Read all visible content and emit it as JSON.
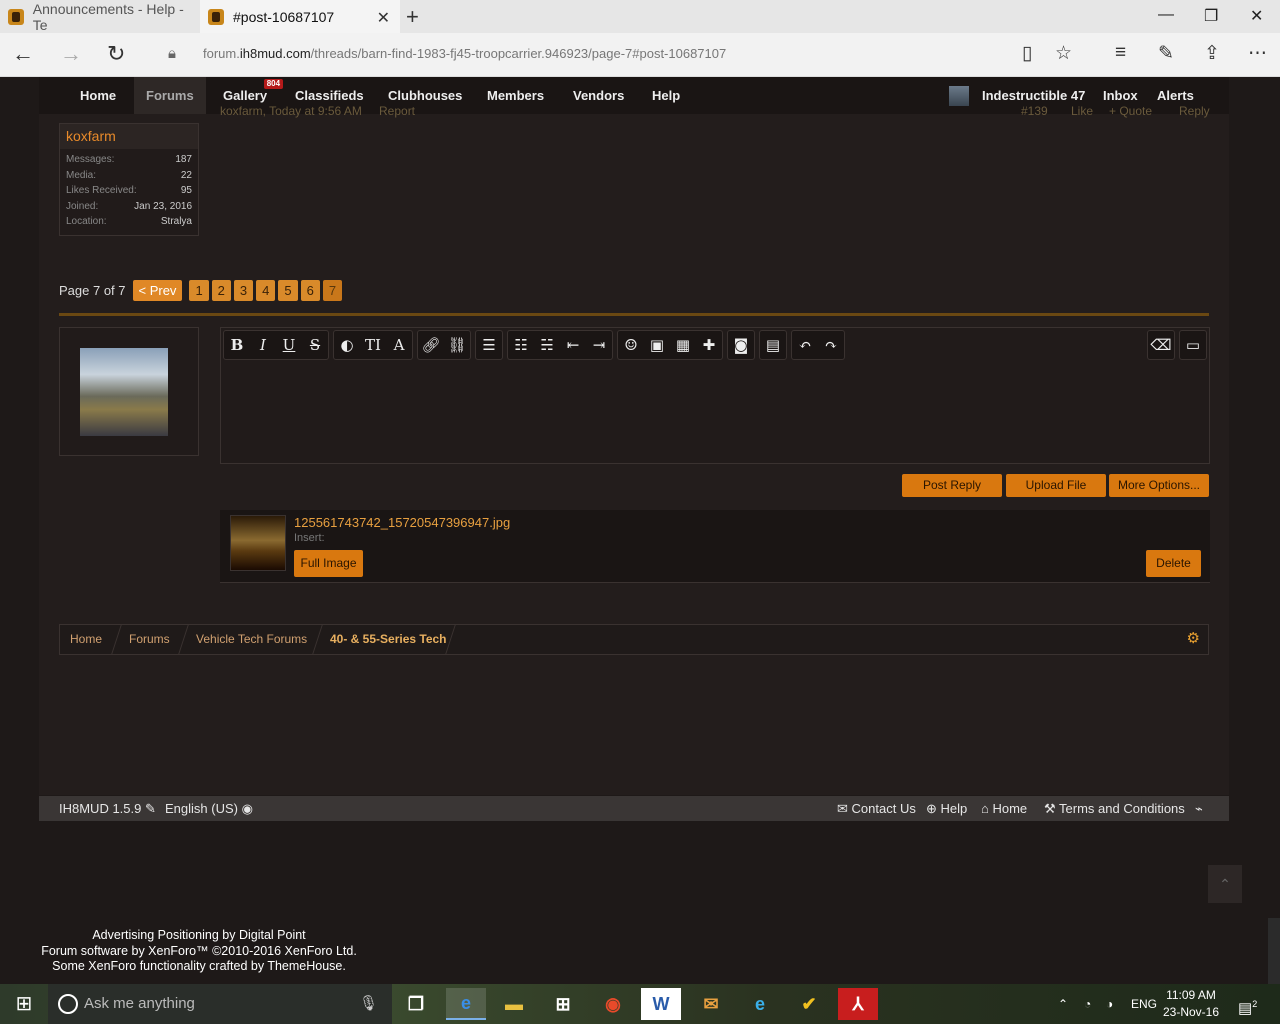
{
  "browser": {
    "tabs": [
      {
        "title": "Announcements - Help - Te"
      },
      {
        "title": "#post-10687107"
      }
    ],
    "url_prefix": "forum.",
    "url_domain": "ih8mud.com",
    "url_path": "/threads/barn-find-1983-fj45-troopcarrier.946923/page-7#post-10687107"
  },
  "nav": {
    "home": "Home",
    "forums": "Forums",
    "gallery": "Gallery",
    "gallery_badge": "804",
    "classifieds": "Classifieds",
    "clubhouses": "Clubhouses",
    "members": "Members",
    "vendors": "Vendors",
    "help": "Help",
    "username": "Indestructible 47",
    "inbox": "Inbox",
    "alerts": "Alerts"
  },
  "post_meta": {
    "author_time": "koxfarm, Today at 9:56 AM",
    "report": "Report",
    "number": "#139",
    "like": "Like",
    "quote": "+ Quote",
    "reply": "Reply"
  },
  "user": {
    "name": "koxfarm",
    "stats": [
      {
        "label": "Messages:",
        "value": "187"
      },
      {
        "label": "Media:",
        "value": "22"
      },
      {
        "label": "Likes Received:",
        "value": "95"
      },
      {
        "label": "Joined:",
        "value": "Jan 23, 2016"
      },
      {
        "label": "Location:",
        "value": "Stralya"
      }
    ]
  },
  "pager": {
    "label": "Page 7 of 7",
    "prev": "< Prev",
    "pages": [
      "1",
      "2",
      "3",
      "4",
      "5",
      "6",
      "7"
    ],
    "current": "7"
  },
  "editor": {
    "buttons": {
      "post_reply": "Post Reply",
      "upload_file": "Upload File",
      "more_options": "More Options..."
    }
  },
  "attachment": {
    "filename": "125561743742_15720547396947.jpg",
    "insert_label": "Insert:",
    "full_image": "Full Image",
    "delete": "Delete"
  },
  "breadcrumb": {
    "items": [
      "Home",
      "Forums",
      "Vehicle Tech Forums",
      "40- & 55-Series Tech"
    ]
  },
  "footer": {
    "version": "IH8MUD 1.5.9",
    "language": "English (US)",
    "contact": "Contact Us",
    "help": "Help",
    "home": "Home",
    "terms": "Terms and Conditions"
  },
  "credits": {
    "line1": "Advertising Positioning by Digital Point",
    "line2": "Forum software by XenForo™ ©2010-2016 XenForo Ltd.",
    "line3": "Some XenForo functionality crafted by ThemeHouse."
  },
  "taskbar": {
    "search_placeholder": "Ask me anything",
    "lang": "ENG",
    "time": "11:09 AM",
    "date": "23-Nov-16",
    "notif_count": "2"
  },
  "colors": {
    "accent": "#d9780f",
    "link": "#e88a2a",
    "page_bg": "#231d1c"
  }
}
